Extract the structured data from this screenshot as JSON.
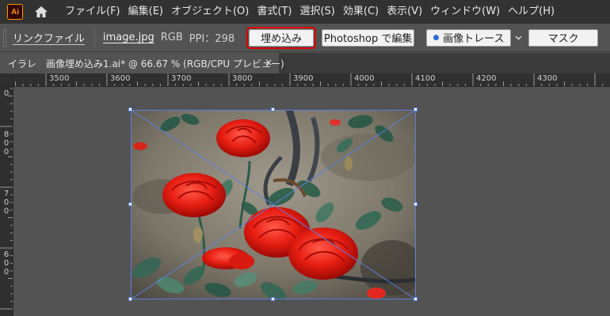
{
  "app": {
    "icon_text": "Ai"
  },
  "menu": [
    "ファイル(F)",
    "編集(E)",
    "オブジェクト(O)",
    "書式(T)",
    "選択(S)",
    "効果(C)",
    "表示(V)",
    "ウィンドウ(W)",
    "ヘルプ(H)"
  ],
  "control": {
    "link_label": "リンクファイル",
    "filename": "image.jpg",
    "color_mode": "RGB",
    "ppi": "PPI：298",
    "embed_button": "埋め込み",
    "photoshop_button": "Photoshop で編集",
    "trace_button": "画像トレース",
    "mask_button": "マスク",
    "highlight_color": "#e00000"
  },
  "tab": {
    "label": "イラレ　画像埋め込み1.ai* @ 66.67 % (RGB/CPU プレビュー)",
    "close": "×"
  },
  "ruler": {
    "horizontal": [
      "3500",
      "3600",
      "3700",
      "3800",
      "3900",
      "4000",
      "4100",
      "4200",
      "4300"
    ],
    "vertical": [
      "0",
      "800",
      "700",
      "600"
    ]
  },
  "selection_color": "#5c7fe0"
}
